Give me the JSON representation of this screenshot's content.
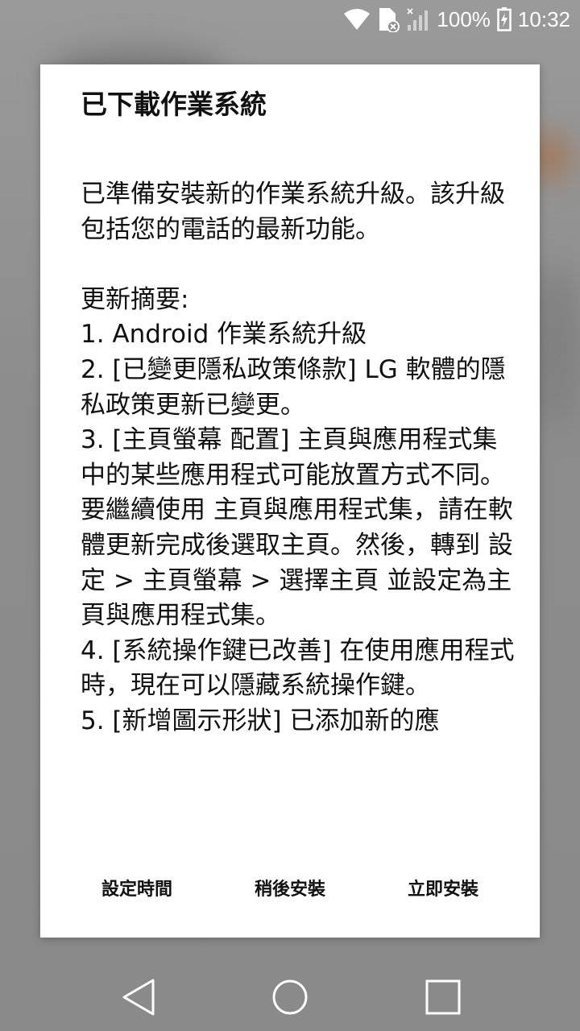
{
  "status_bar": {
    "battery_percent": "100%",
    "time": "10:32",
    "icons": [
      "wifi-icon",
      "no-sim-icon",
      "signal-icon",
      "battery-charging-icon"
    ]
  },
  "dialog": {
    "title": "已下載作業系統",
    "body": "已準備安裝新的作業系統升級。該升級包括您的電話的最新功能。\n\n更新摘要:\n1. Android 作業系統升級\n2. [已變更隱私政策條款] LG 軟體的隱私政策更新已變更。\n3. [主頁螢幕 配置] 主頁與應用程式集 中的某些應用程式可能放置方式不同。要繼續使用 主頁與應用程式集，請在軟體更新完成後選取主頁。然後，轉到 設定 > 主頁螢幕 > 選擇主頁 並設定為主頁與應用程式集。\n4. [系統操作鍵已改善] 在使用應用程式時，現在可以隱藏系統操作鍵。\n5. [新增圖示形狀] 已添加新的應",
    "buttons": {
      "set_time": "設定時間",
      "install_later": "稍後安裝",
      "install_now": "立即安裝"
    }
  },
  "nav_bar": {
    "icons": [
      "back-icon",
      "home-icon",
      "recents-icon"
    ]
  }
}
